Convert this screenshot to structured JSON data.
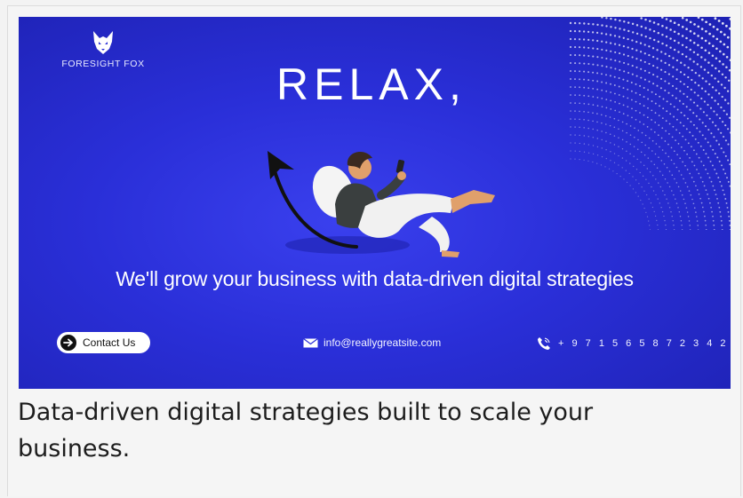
{
  "banner": {
    "logo_text": "FORESIGHT FOX",
    "headline": "RELAX,",
    "tagline": "We'll grow your business with data-driven digital strategies",
    "contact_label": "Contact Us",
    "email": "info@reallygreatsite.com",
    "phone": "+ 9 7 1 5 6 5 8 7 2 3 4 2",
    "colors": {
      "background": "#2a2fd8",
      "text": "#ffffff"
    },
    "icons": [
      "fox-logo-icon",
      "arrow-right-icon",
      "envelope-icon",
      "phone-icon",
      "dot-pattern"
    ]
  },
  "caption": "Data-driven digital strategies built to scale your business."
}
